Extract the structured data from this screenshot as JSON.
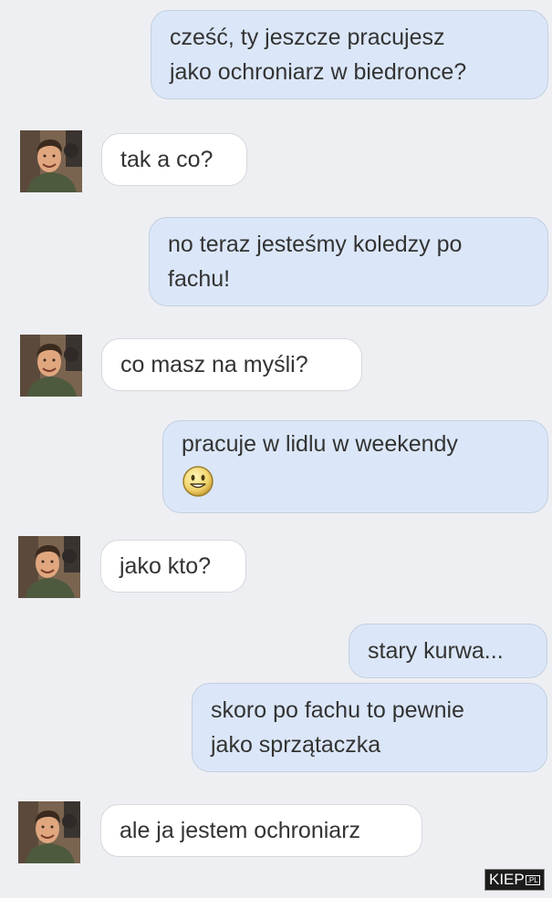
{
  "messages": [
    {
      "side": "out",
      "lines": [
        "cześć, ty jeszcze pracujesz",
        "jako ochroniarz w biedronce?"
      ]
    },
    {
      "side": "in",
      "lines": [
        "tak a co?"
      ]
    },
    {
      "side": "out",
      "lines": [
        "no teraz jesteśmy koledzy po",
        "fachu!"
      ]
    },
    {
      "side": "in",
      "lines": [
        "co masz na myśli?"
      ]
    },
    {
      "side": "out",
      "lines": [
        "pracuje w lidlu w weekendy"
      ],
      "emoji": "smiley-icon"
    },
    {
      "side": "in",
      "lines": [
        "jako kto?"
      ]
    },
    {
      "side": "out",
      "lines": [
        "stary kurwa..."
      ]
    },
    {
      "side": "out",
      "lines": [
        "skoro po fachu to pewnie",
        "jako sprzątaczka"
      ]
    },
    {
      "side": "in",
      "lines": [
        "ale ja jestem ochroniarz"
      ]
    }
  ],
  "watermark": {
    "main": "KIEP",
    "suffix": ".PL"
  },
  "colors": {
    "background": "#eeeff3",
    "outgoing_bubble": "#dbe7f8",
    "incoming_bubble": "#ffffff",
    "text": "#333333"
  }
}
